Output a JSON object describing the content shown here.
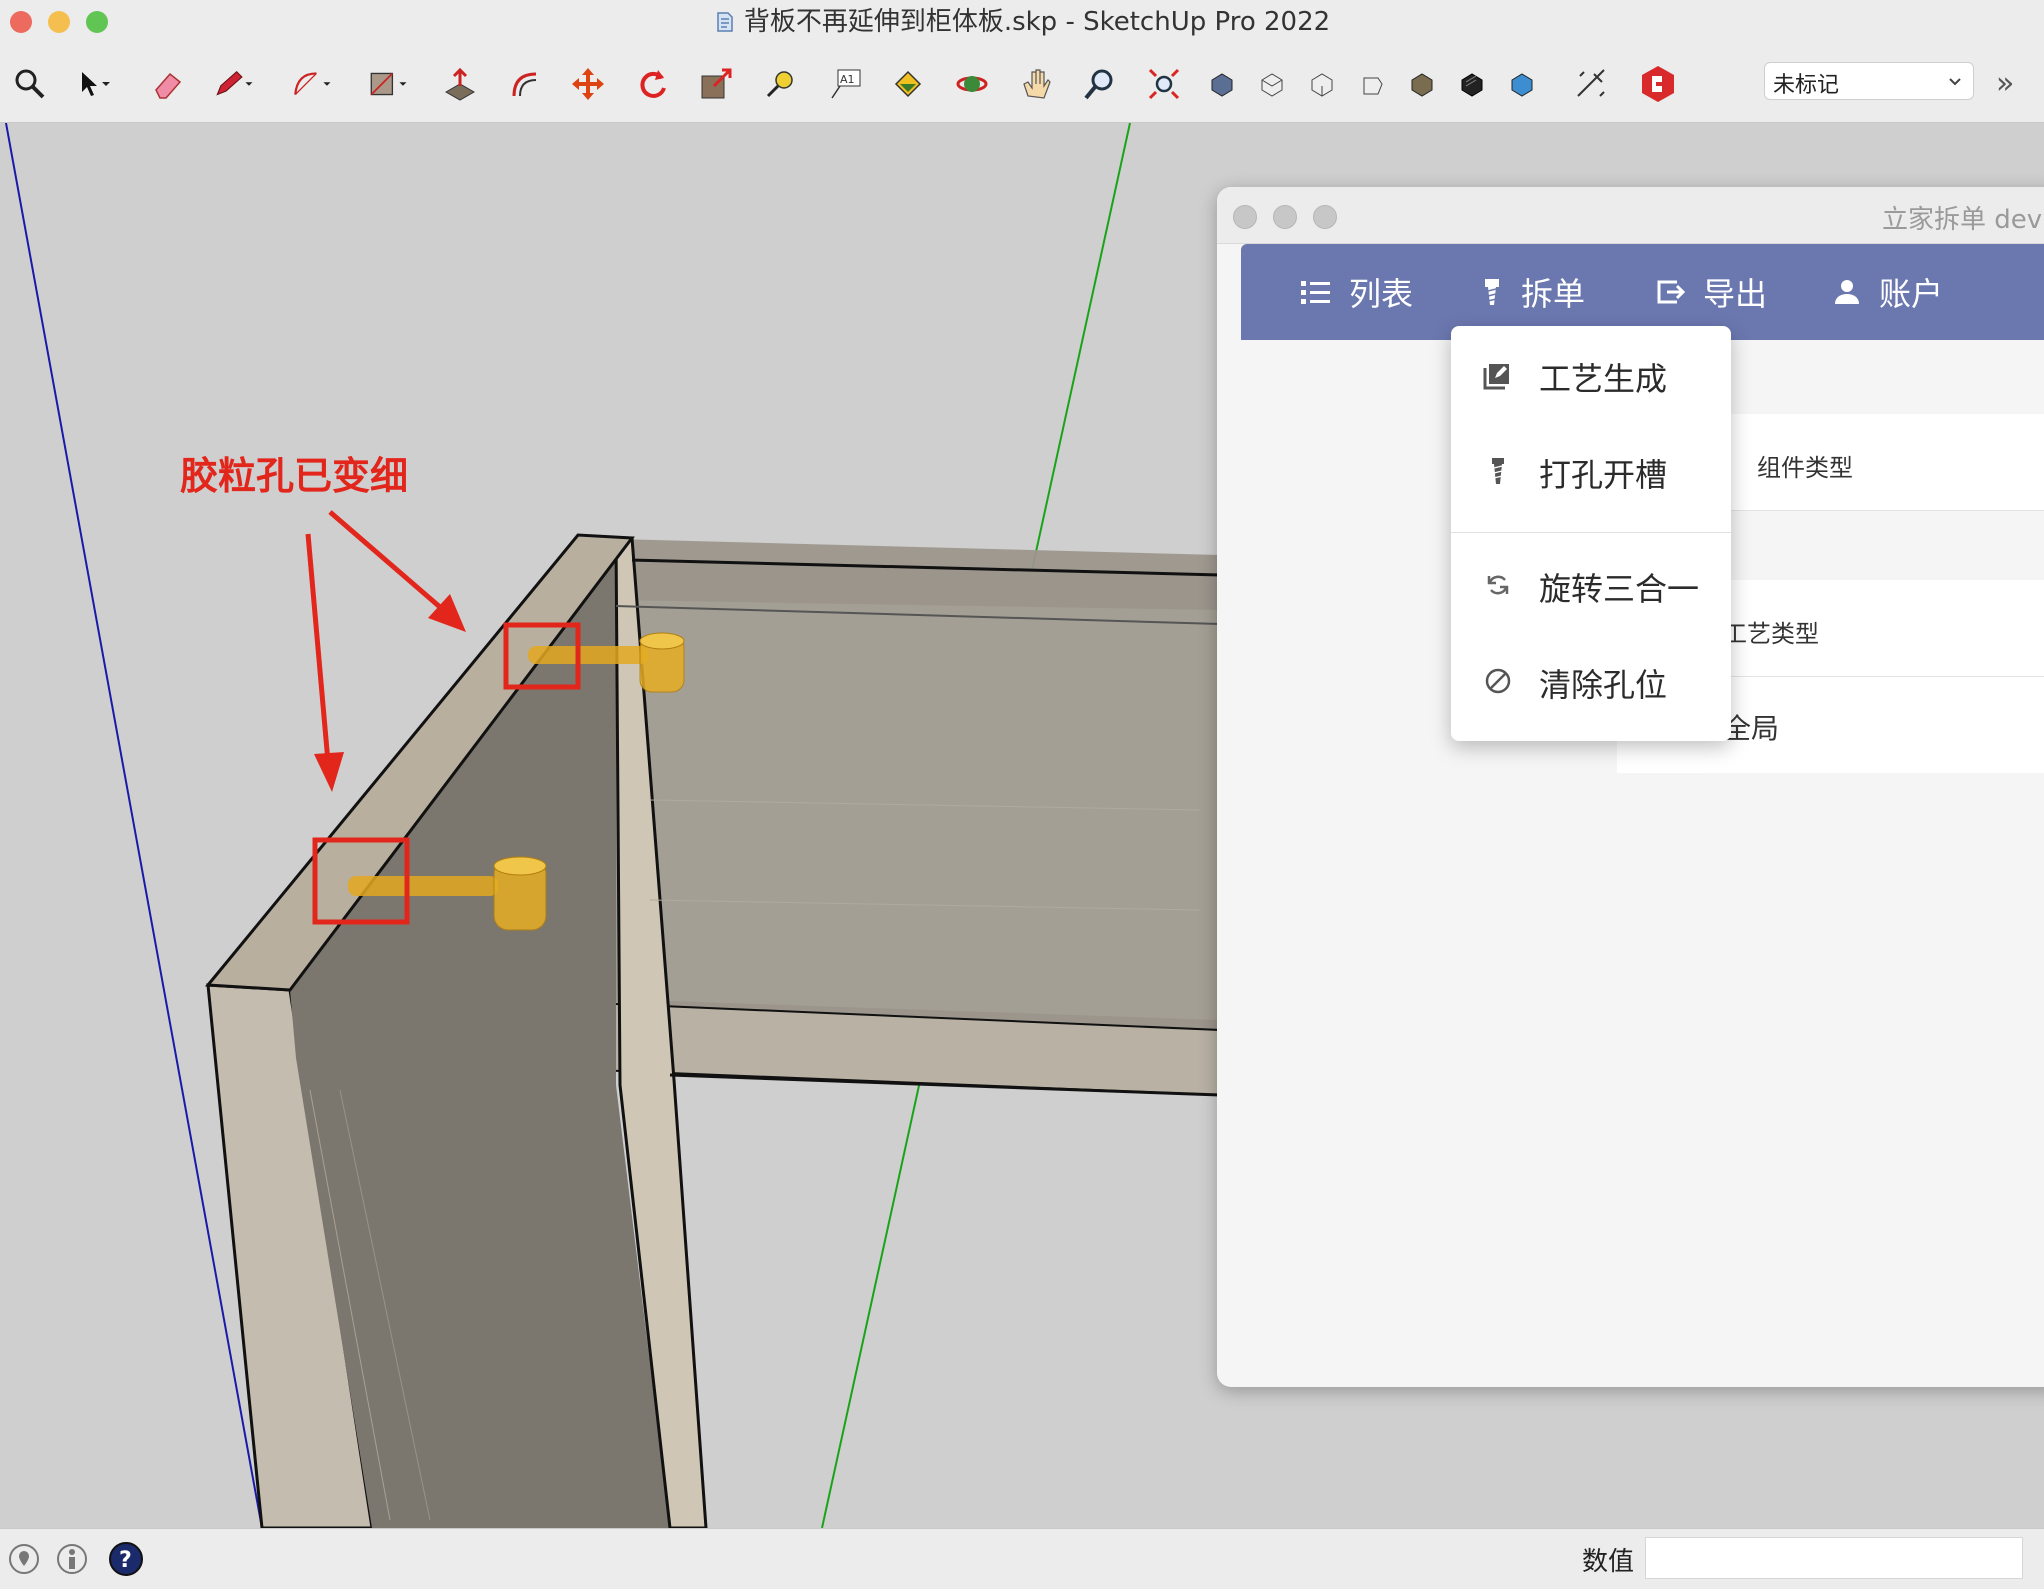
{
  "window": {
    "title": "背板不再延伸到柜体板.skp - SketchUp Pro 2022",
    "traffic_colors": {
      "close": "#ed6a5e",
      "minimize": "#f5bf4f",
      "zoom": "#61c554"
    }
  },
  "toolbar": {
    "tools": [
      {
        "name": "zoom-icon"
      },
      {
        "name": "select-icon"
      },
      {
        "name": "eraser-icon"
      },
      {
        "name": "pencil-icon"
      },
      {
        "name": "arc-icon"
      },
      {
        "name": "rectangle-icon"
      },
      {
        "name": "push-pull-icon"
      },
      {
        "name": "offset-icon"
      },
      {
        "name": "move-icon"
      },
      {
        "name": "rotate-icon"
      },
      {
        "name": "scale-icon"
      },
      {
        "name": "tape-measure-icon"
      },
      {
        "name": "text-icon"
      },
      {
        "name": "paint-bucket-icon"
      },
      {
        "name": "orbit-icon"
      },
      {
        "name": "pan-icon"
      },
      {
        "name": "zoom-window-icon"
      },
      {
        "name": "zoom-extents-icon"
      },
      {
        "name": "iso-view-icon"
      },
      {
        "name": "top-view-icon"
      },
      {
        "name": "front-view-icon"
      },
      {
        "name": "right-view-icon"
      },
      {
        "name": "back-view-icon"
      },
      {
        "name": "left-view-icon"
      },
      {
        "name": "bottom-view-icon"
      },
      {
        "name": "section-plane-icon"
      },
      {
        "name": "plugin-logo-icon"
      }
    ],
    "tag_select": "未标记",
    "more_label": "»"
  },
  "annotation": {
    "text": "胶粒孔已变细",
    "color": "#e2261c"
  },
  "plugin": {
    "title": "立家拆单 dev",
    "nav": [
      {
        "label": "列表",
        "icon": "list-icon"
      },
      {
        "label": "拆单",
        "icon": "drill-icon"
      },
      {
        "label": "导出",
        "icon": "export-icon"
      },
      {
        "label": "账户",
        "icon": "user-icon"
      }
    ],
    "accent": "#6b78b0",
    "content": {
      "component_type_header": "组件类型",
      "process_type_header": "工艺类型",
      "scope_value": "全局"
    },
    "dropdown": [
      {
        "label": "工艺生成",
        "icon": "edit-icon"
      },
      {
        "label": "打孔开槽",
        "icon": "drill-icon"
      },
      {
        "label": "旋转三合一",
        "icon": "rotate-arrows-icon"
      },
      {
        "label": "清除孔位",
        "icon": "prohibit-icon"
      }
    ]
  },
  "statusbar": {
    "measure_label": "数值",
    "measure_value": ""
  }
}
